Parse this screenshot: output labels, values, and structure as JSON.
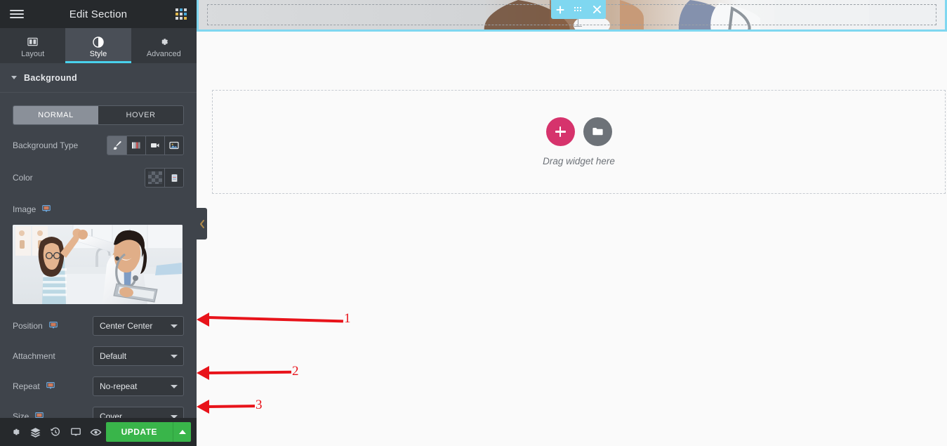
{
  "panel": {
    "header": {
      "title": "Edit Section",
      "menu_icon": "hamburger-icon",
      "widgets_icon": "widgets-grid-icon"
    },
    "tabs": [
      {
        "label": "Layout",
        "icon": "columns-icon",
        "active": false
      },
      {
        "label": "Style",
        "icon": "contrast-icon",
        "active": true
      },
      {
        "label": "Advanced",
        "icon": "gear-icon",
        "active": false
      }
    ],
    "section": {
      "title": "Background",
      "collapsed": false
    },
    "state_switcher": {
      "normal": "NORMAL",
      "hover": "HOVER",
      "selected": "NORMAL"
    },
    "controls": {
      "background_type": {
        "label": "Background Type",
        "options": [
          "classic-brush-icon",
          "gradient-icon",
          "video-icon",
          "slideshow-icon"
        ],
        "selected": "classic-brush-icon"
      },
      "color": {
        "label": "Color",
        "swatch": "transparent-checker",
        "palette_icon": "palette-icon"
      },
      "image": {
        "label": "Image",
        "device_icon": "desktop-icon",
        "thumbnail_alt": "doctor high-fiving child"
      },
      "position": {
        "label": "Position",
        "device_icon": "desktop-icon",
        "value": "Center Center"
      },
      "attachment": {
        "label": "Attachment",
        "value": "Default"
      },
      "repeat": {
        "label": "Repeat",
        "device_icon": "desktop-icon",
        "value": "No-repeat"
      },
      "size": {
        "label": "Size",
        "device_icon": "desktop-icon",
        "value": "Cover"
      }
    },
    "footer": {
      "icons": [
        "settings-gear-icon",
        "navigator-layers-icon",
        "history-clock-icon",
        "responsive-monitor-icon",
        "preview-eye-icon"
      ],
      "update_label": "UPDATE",
      "update_caret_icon": "chevron-up-icon",
      "update_color": "#39b54a"
    }
  },
  "canvas": {
    "section_toolbar": {
      "add_icon": "plus-icon",
      "drag_icon": "drag-dots-icon",
      "close_icon": "close-x-icon",
      "color": "#7fd7f0"
    },
    "dropzone": {
      "add_widget_icon": "plus-circle-icon",
      "template_icon": "folder-circle-icon",
      "text": "Drag widget here",
      "add_color": "#d6336c",
      "folder_color": "#6d7278"
    },
    "collapse_tab": {
      "icon": "chevron-left-icon"
    }
  },
  "annotations": [
    {
      "number": "1",
      "color": "#e8131a"
    },
    {
      "number": "2",
      "color": "#e8131a"
    },
    {
      "number": "3",
      "color": "#e8131a"
    }
  ]
}
